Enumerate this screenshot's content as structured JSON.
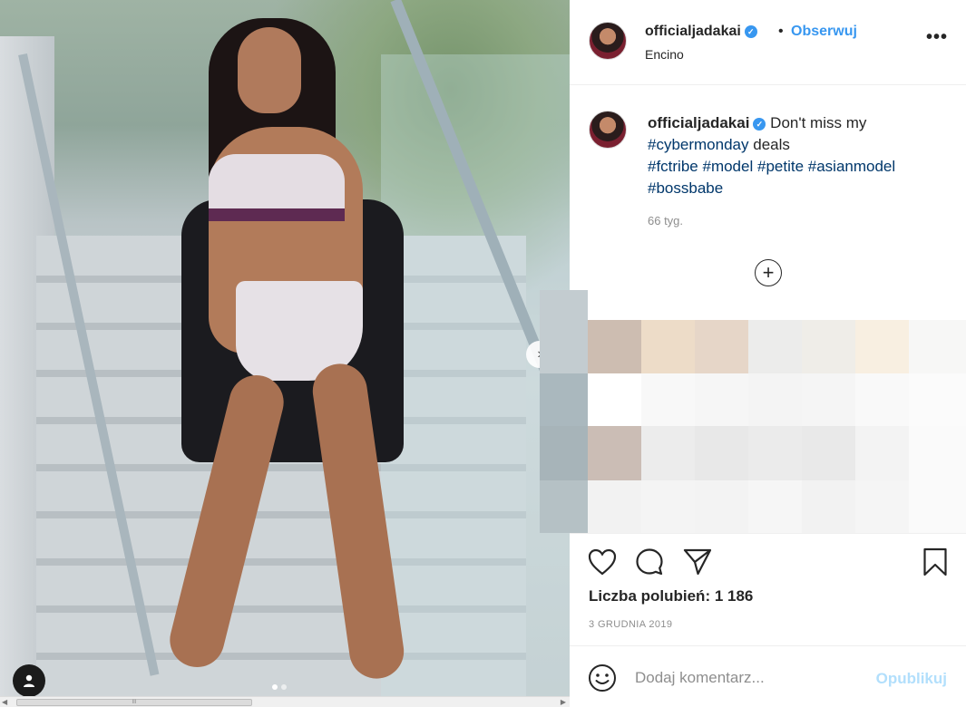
{
  "post": {
    "username": "officialjadakai",
    "dot_separator": "•",
    "follow_label": "Obserwuj",
    "location": "Encino",
    "more_label": "•••",
    "caption_text": "Don't miss my",
    "tags": [
      "#cybermonday",
      "#fctribe",
      "#model",
      "#petite",
      "#asianmodel",
      "#bossbabe"
    ],
    "deals_word": "deals",
    "age": "66 tyg.",
    "likes_text": "Liczba polubień: 1 186",
    "date": "3 GRUDNIA 2019"
  },
  "comment": {
    "placeholder": "Dodaj komentarz...",
    "publish_label": "Opublikuj"
  },
  "icons": {
    "verified": "verified-badge-icon",
    "load_more": "plus-circle-icon",
    "like": "heart-icon",
    "comment": "comment-bubble-icon",
    "share": "paper-plane-icon",
    "save": "bookmark-icon",
    "emoji": "smiley-icon",
    "next": "chevron-right-icon",
    "user": "user-icon"
  },
  "carousel": {
    "total": 2,
    "active": 1
  },
  "scrollbar": {
    "grip": "III"
  },
  "colors": {
    "accent": "#3897f0",
    "hashtag": "#00376b",
    "muted": "#8e8e8e",
    "publish_disabled": "#b2dffc"
  }
}
